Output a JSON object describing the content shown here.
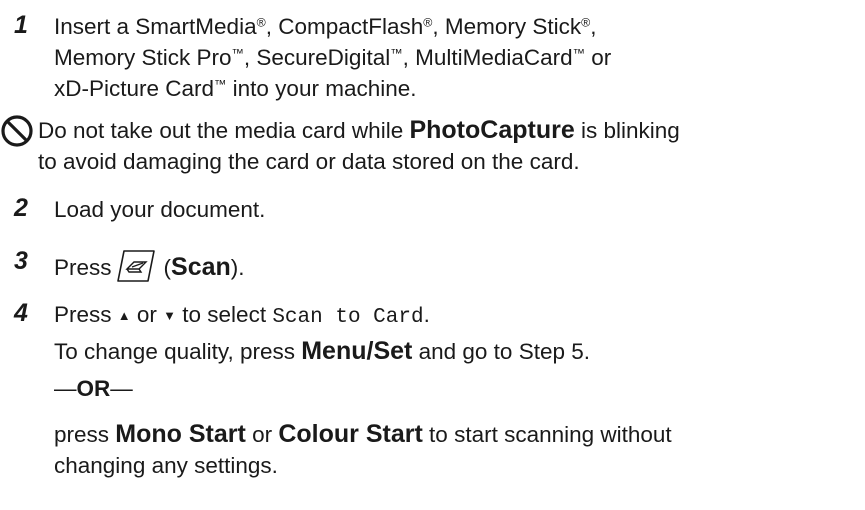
{
  "steps": {
    "s1": {
      "number": "1",
      "line1": {
        "t1": "Insert a SmartMedia",
        "r1": "®",
        "t2": ", CompactFlash",
        "r2": "®",
        "t3": ", Memory Stick",
        "r3": "®",
        "t4": ","
      },
      "line2": {
        "t1": "Memory Stick Pro",
        "tm1": "™",
        "t2": ", SecureDigital",
        "tm2": "™",
        "t3": ", MultiMediaCard",
        "tm3": "™",
        "t4": " or"
      },
      "line3": {
        "t1": "xD-Picture Card",
        "tm1": "™",
        "t2": " into your machine."
      }
    },
    "s2": {
      "number": "2",
      "text": "Load your document."
    },
    "s3": {
      "number": "3",
      "prefix": "Press",
      "open": "(",
      "key": "Scan",
      "close": ")."
    },
    "s4": {
      "number": "4",
      "line1": {
        "press": "Press ",
        "up": "▲",
        "or": " or ",
        "down": "▼",
        "select": " to select ",
        "code": "Scan to Card",
        "end": "."
      },
      "line2": {
        "t1": "To change quality, press ",
        "key": "Menu/Set",
        "t2": " and go to Step 5."
      },
      "or_line": {
        "d1": "—",
        "or": "OR",
        "d2": "—"
      },
      "line4": {
        "t1": "press ",
        "key1": "Mono Start",
        "t2": " or ",
        "key2": "Colour Start",
        "t3": " to start scanning without"
      },
      "line5": "changing any settings."
    }
  },
  "caution": {
    "icon": "prohibited-icon",
    "line1": {
      "t1": "Do not take out the media card while ",
      "key": "PhotoCapture",
      "t2": " is blinking"
    },
    "line2": "to avoid damaging the card or data stored on the card."
  },
  "scan_key_icon": "scanner-key-icon"
}
